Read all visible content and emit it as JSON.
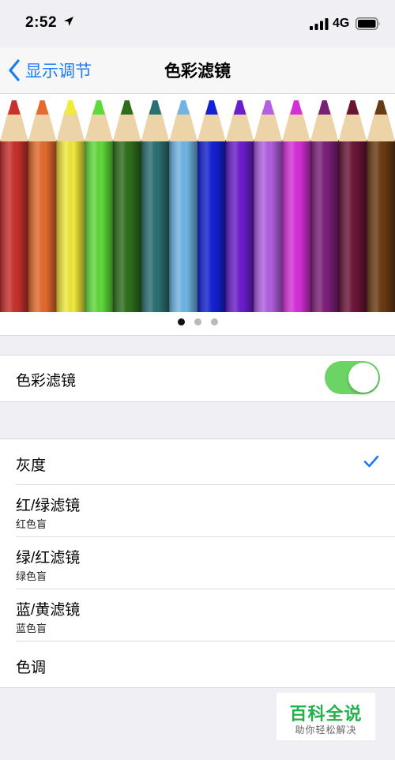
{
  "status": {
    "time": "2:52",
    "network": "4G"
  },
  "nav": {
    "back_label": "显示调节",
    "title": "色彩滤镜"
  },
  "carousel": {
    "page_count": 3,
    "active_page": 1
  },
  "pencil_colors": [
    "#c9302c",
    "#e46a2e",
    "#f2ea3a",
    "#5fd93a",
    "#2d6e1d",
    "#2a6f72",
    "#6fb5e4",
    "#1420d4",
    "#6a1ecc",
    "#b25fe0",
    "#d62fd8",
    "#7a1f78",
    "#6b1436",
    "#6a3a12"
  ],
  "color_filters_toggle": {
    "label": "色彩滤镜",
    "enabled": true
  },
  "filters": [
    {
      "label": "灰度",
      "sublabel": "",
      "selected": true
    },
    {
      "label": "红/绿滤镜",
      "sublabel": "红色盲",
      "selected": false
    },
    {
      "label": "绿/红滤镜",
      "sublabel": "绿色盲",
      "selected": false
    },
    {
      "label": "蓝/黄滤镜",
      "sublabel": "蓝色盲",
      "selected": false
    },
    {
      "label": "色调",
      "sublabel": "",
      "selected": false
    }
  ],
  "colors": {
    "accent": "#1a7cf5",
    "toggle_on": "#6cd464",
    "watermark": "#22b14c"
  },
  "watermark": {
    "title": "百科全说",
    "subtitle": "助你轻松解决"
  }
}
